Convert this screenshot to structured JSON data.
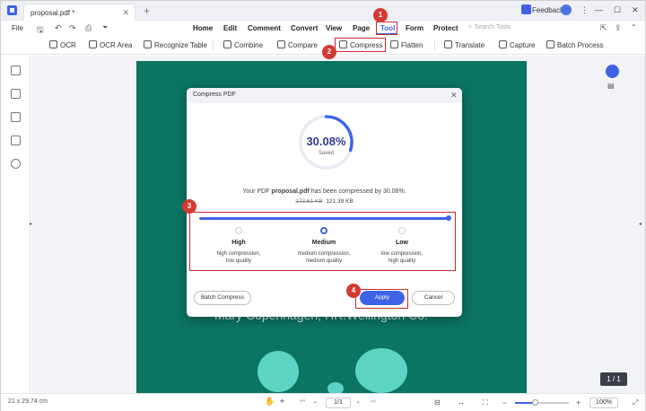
{
  "window": {
    "tab_title": "proposal.pdf *",
    "feedback": "Feedback"
  },
  "menu": {
    "file": "File",
    "items": [
      "Home",
      "Edit",
      "Comment",
      "Convert",
      "View",
      "Page",
      "Tool",
      "Form",
      "Protect"
    ],
    "search_placeholder": "Search Tools"
  },
  "toolbar": {
    "items": [
      "OCR",
      "OCR Area",
      "Recognize Table",
      "Combine",
      "Compare",
      "Compress",
      "Flatten",
      "Translate",
      "Capture",
      "Batch Process"
    ]
  },
  "document": {
    "background_text": "Mary Copenhagen, HR.Wellington Co.",
    "page_badge": "1 / 1"
  },
  "dialog": {
    "title": "Compress PDF",
    "percent": "30.08%",
    "percent_value": 30.08,
    "saved_label": "Saved",
    "msg_prefix": "Your PDF",
    "file_name": "proposal.pdf",
    "msg_middle": "has been compressed by",
    "msg_percent": "30.08%.",
    "original_size": "173.61 KB",
    "new_size": "121.39 KB",
    "options": [
      {
        "label": "High",
        "desc1": "high compression,",
        "desc2": "low quality"
      },
      {
        "label": "Medium",
        "desc1": "medium compression,",
        "desc2": "medium quality"
      },
      {
        "label": "Low",
        "desc1": "low compression,",
        "desc2": "high quality"
      }
    ],
    "batch_button": "Batch Compress",
    "apply_button": "Apply",
    "cancel_button": "Cancel"
  },
  "status": {
    "page_size": "21 x 29.74 cm",
    "page_input": "1/1",
    "zoom": "100%"
  },
  "annotations": [
    "1",
    "2",
    "3",
    "4"
  ],
  "colors": {
    "accent": "#3e63e6",
    "doc_bg": "#0b7463",
    "annotation": "#d23a33"
  }
}
